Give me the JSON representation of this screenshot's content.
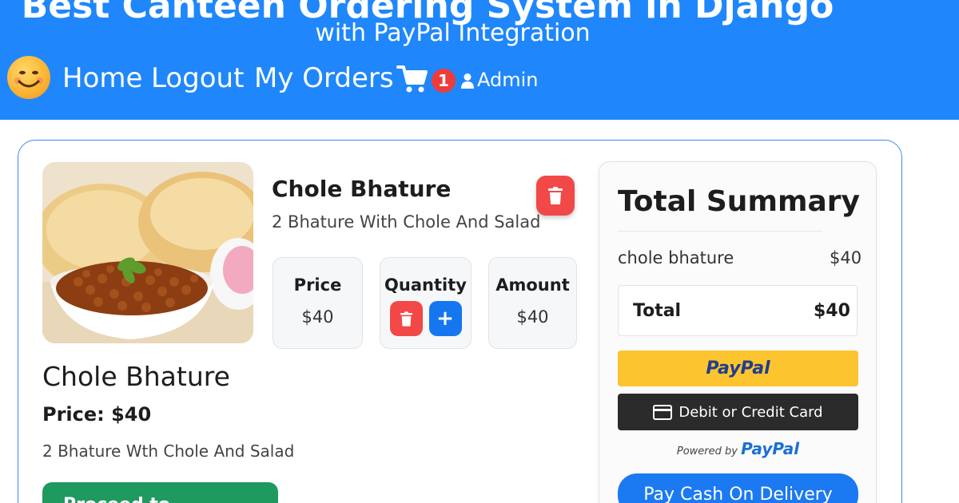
{
  "header": {
    "title": "Best Canteen Ordering System in Django",
    "subtitle": "with PayPal Integration",
    "bg_color": "#1f87fb",
    "logo_icon": "smiley-face-icon",
    "nav": {
      "home": "Home",
      "logout": "Logout",
      "my_orders": "My Orders"
    },
    "cart_icon": "shopping-cart-icon",
    "cart_count": "1",
    "user_icon": "user-icon",
    "user_name": "Admin"
  },
  "cart_item": {
    "title": "Chole Bhature",
    "description": "2 Bhature With Chole And Salad",
    "delete_icon": "trash-icon",
    "price_label": "Price",
    "price_value": "$40",
    "quantity_label": "Quantity",
    "quantity_decrement_icon": "trash-icon",
    "quantity_increment": "+",
    "amount_label": "Amount",
    "amount_value": "$40"
  },
  "product_detail": {
    "title": "Chole Bhature",
    "price": "Price: $40",
    "description": "2 Bhature Wth Chole And Salad",
    "button_label": "Proceed to..."
  },
  "summary": {
    "title": "Total Summary",
    "items": [
      {
        "name": "chole bhature",
        "amount": "$40"
      }
    ],
    "total_label": "Total",
    "total_amount": "$40",
    "paypal_label": "PayPal",
    "card_label": "Debit or Credit Card",
    "powered_by_prefix": "Powered by",
    "powered_by_brand": "PayPal",
    "cod_label": "Pay Cash On Delivery"
  },
  "colors": {
    "accent": "#1f87fb",
    "danger": "#f24848",
    "primary_button": "#1576f0",
    "paypal_yellow": "#fcc42e",
    "success": "#1e9a5f"
  }
}
